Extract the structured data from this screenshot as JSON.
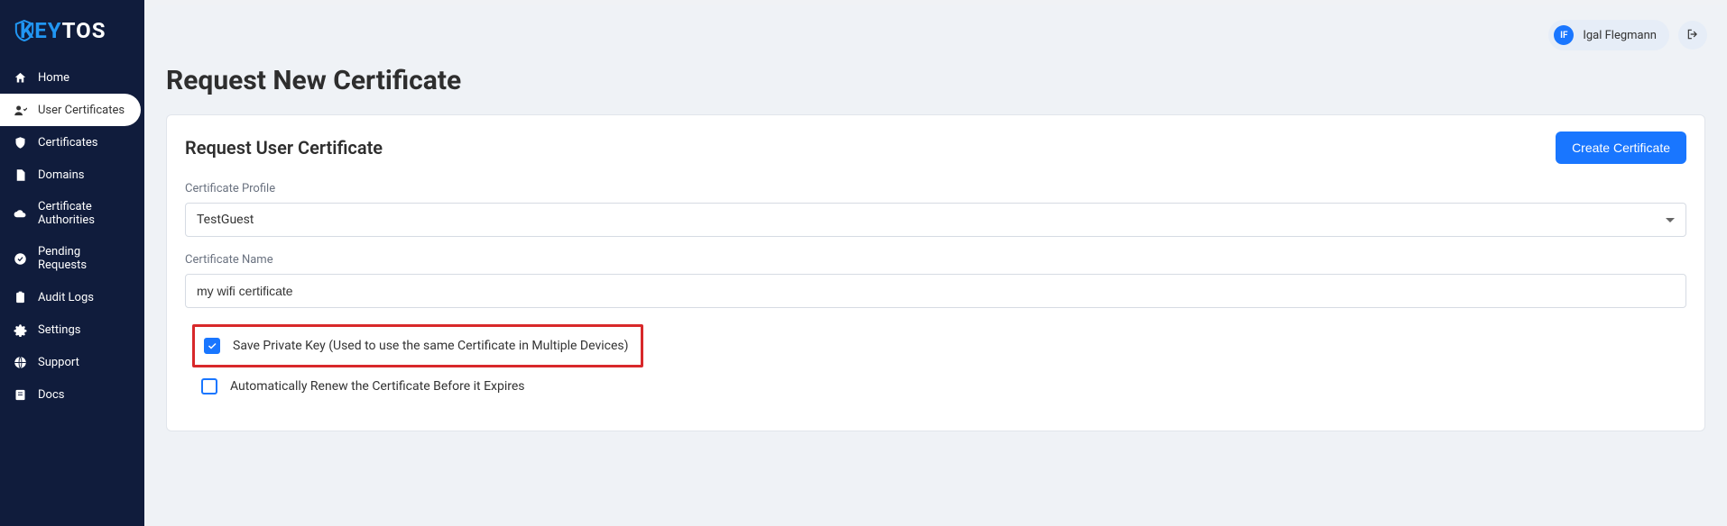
{
  "brand": {
    "key": "KEY",
    "tos": "TOS"
  },
  "sidebar": {
    "items": [
      {
        "label": "Home"
      },
      {
        "label": "User Certificates"
      },
      {
        "label": "Certificates"
      },
      {
        "label": "Domains"
      },
      {
        "label": "Certificate Authorities"
      },
      {
        "label": "Pending Requests"
      },
      {
        "label": "Audit Logs"
      },
      {
        "label": "Settings"
      },
      {
        "label": "Support"
      },
      {
        "label": "Docs"
      }
    ]
  },
  "user": {
    "initials": "IF",
    "name": "Igal Flegmann"
  },
  "page": {
    "title": "Request New Certificate"
  },
  "card": {
    "title": "Request User Certificate",
    "action_label": "Create Certificate"
  },
  "form": {
    "profile_label": "Certificate Profile",
    "profile_value": "TestGuest",
    "name_label": "Certificate Name",
    "name_value": "my wifi certificate",
    "save_key_label": "Save Private Key (Used to use the same Certificate in Multiple Devices)",
    "save_key_checked": true,
    "auto_renew_label": "Automatically Renew the Certificate Before it Expires",
    "auto_renew_checked": false
  }
}
